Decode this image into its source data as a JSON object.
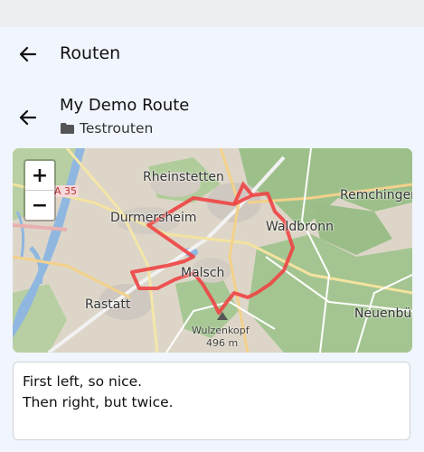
{
  "topbar": {
    "title": "Routen"
  },
  "route": {
    "name": "My Demo Route",
    "folder": "Testrouten"
  },
  "map": {
    "zoom_in_label": "+",
    "zoom_out_label": "−",
    "labels": {
      "rheinstetten": "Rheinstetten",
      "remchingen": "Remchingen",
      "durmersheim": "Durmersheim",
      "waldbronn": "Waldbronn",
      "malsch": "Malsch",
      "rastatt": "Rastatt",
      "neuenbuerg": "Neuenbü",
      "peak": "Wulzenkopf",
      "peak_elev": "496 m",
      "road": "A 35"
    },
    "route_color": "#ee4444"
  },
  "notes": {
    "text": "First left, so nice.\nThen right, but twice."
  }
}
